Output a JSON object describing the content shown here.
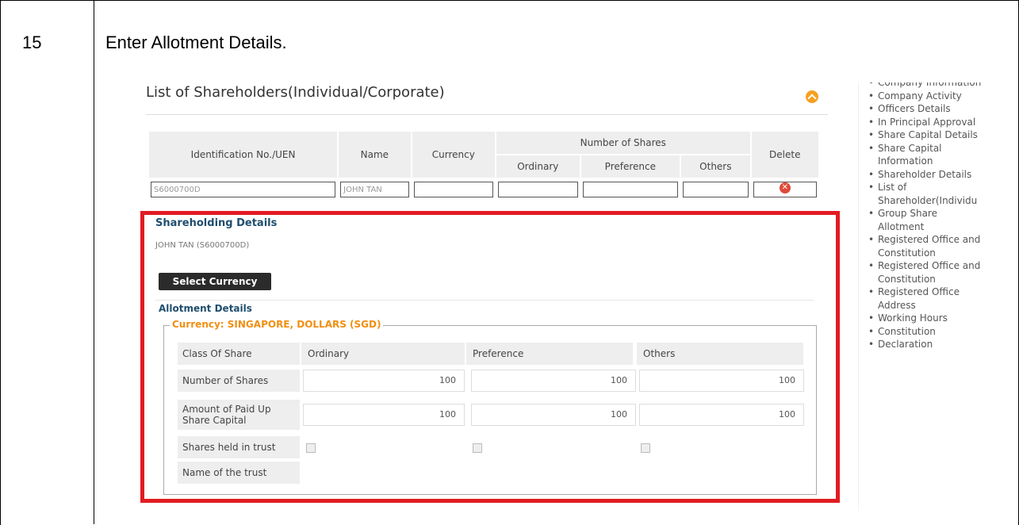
{
  "document": {
    "step_number": "15",
    "step_text": "Enter Allotment Details."
  },
  "panel": {
    "title": "List of Shareholders(Individual/Corporate)"
  },
  "shareholders_table": {
    "headers": {
      "id": "Identification No./UEN",
      "name": "Name",
      "currency": "Currency",
      "number_of_shares": "Number of Shares",
      "delete": "Delete"
    },
    "subheaders": [
      "Ordinary",
      "Preference",
      "Others"
    ],
    "row": {
      "id": "S6000700D",
      "name": "JOHN TAN"
    }
  },
  "shareholding": {
    "title": "Shareholding Details",
    "holder": "JOHN TAN (S6000700D)",
    "select_currency_label": "Select Currency",
    "allotment_title": "Allotment Details",
    "currency_legend": "Currency: SINGAPORE, DOLLARS (SGD)",
    "columns": [
      "Ordinary",
      "Preference",
      "Others"
    ],
    "labels": {
      "class_of_share": "Class Of Share",
      "number_of_shares": "Number of Shares",
      "amount_paid_up": "Amount of Paid Up Share Capital",
      "shares_in_trust": "Shares held in trust",
      "trust_name": "Name of the trust"
    },
    "number_of_shares": [
      "100",
      "100",
      "100"
    ],
    "amount_paid_up": [
      "100",
      "100",
      "100"
    ]
  },
  "sidebar": {
    "items": [
      "Company Information",
      "Company Activity",
      "Officers Details",
      "In Principal Approval",
      "Share Capital Details",
      "Share Capital Information",
      "Shareholder Details",
      "List of Shareholder(Individu",
      "Group Share Allotment",
      "Registered Office and Constitution",
      "Registered Office and Constitution",
      "Registered Office Address",
      "Working Hours",
      "Constitution",
      "Declaration"
    ]
  },
  "colors": {
    "highlight_border": "#e21b22",
    "legend_text": "#f08f12",
    "section_title": "#1f4e6e"
  }
}
